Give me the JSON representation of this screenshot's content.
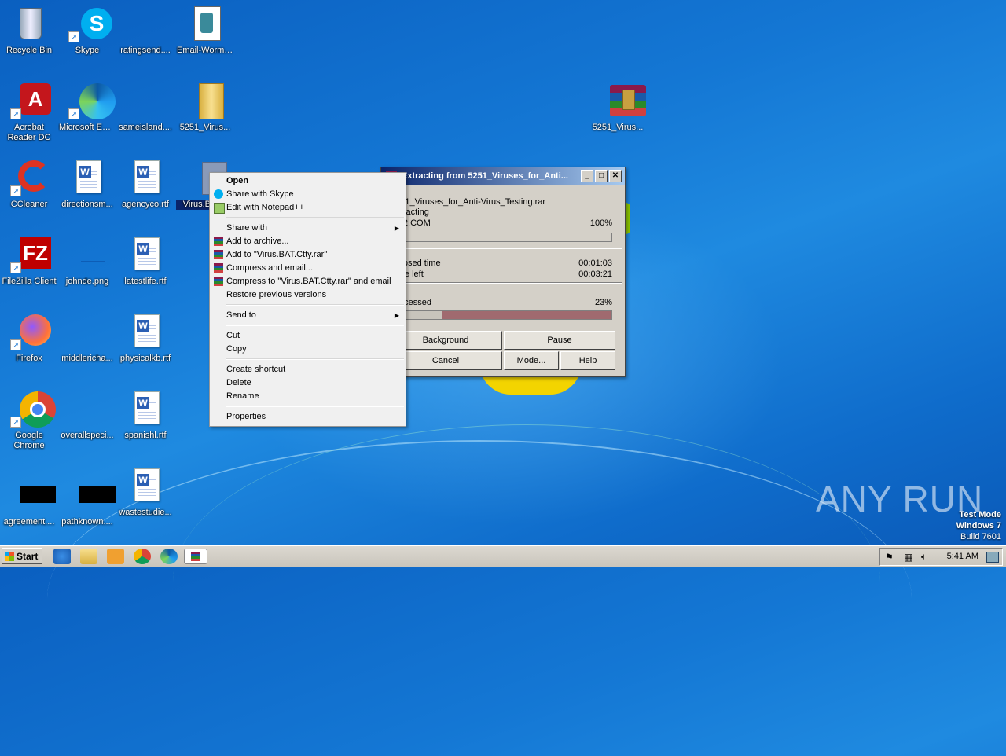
{
  "desktop": {
    "icons": [
      {
        "label": "Recycle Bin"
      },
      {
        "label": "Skype"
      },
      {
        "label": "ratingsend...."
      },
      {
        "label": "Email-Worm...."
      },
      {
        "label": "Acrobat Reader DC"
      },
      {
        "label": "Microsoft Edge"
      },
      {
        "label": "sameisland...."
      },
      {
        "label": "5251_Virus..."
      },
      {
        "label": "5251_Virus..."
      },
      {
        "label": "CCleaner"
      },
      {
        "label": "directionsm..."
      },
      {
        "label": "agencyco.rtf"
      },
      {
        "label": "Virus.BAT..."
      },
      {
        "label": "FileZilla Client"
      },
      {
        "label": "johnde.png"
      },
      {
        "label": "latestlife.rtf"
      },
      {
        "label": "Firefox"
      },
      {
        "label": "middlericha..."
      },
      {
        "label": "physicalkb.rtf"
      },
      {
        "label": "Google Chrome"
      },
      {
        "label": "overallspeci..."
      },
      {
        "label": "spanishl.rtf"
      },
      {
        "label": "agreement...."
      },
      {
        "label": "pathknown...."
      },
      {
        "label": "wastestudie..."
      }
    ]
  },
  "dialog": {
    "title": "Extracting from 5251_Viruses_for_Anti...",
    "archive": "5251_Viruses_for_Anti-Virus_Testing.rar",
    "status": "Extracting",
    "current_file": "-382.COM",
    "file_percent": "100%",
    "file_progress": 1.0,
    "elapsed_label": "Elapsed time",
    "elapsed_value": "00:01:03",
    "left_label": "Time left",
    "left_value": "00:03:21",
    "processed_label": "Processed",
    "processed_percent": "23%",
    "processed_progress": 0.23,
    "buttons": {
      "background": "Background",
      "pause": "Pause",
      "cancel": "Cancel",
      "mode": "Mode...",
      "help": "Help"
    }
  },
  "context_menu": {
    "open": "Open",
    "share_skype": "Share with Skype",
    "edit_notepad": "Edit with Notepad++",
    "share_with": "Share with",
    "add_archive": "Add to archive...",
    "add_rar": "Add to \"Virus.BAT.Ctty.rar\"",
    "compress_email": "Compress and email...",
    "compress_rar_email": "Compress to \"Virus.BAT.Ctty.rar\" and email",
    "restore": "Restore previous versions",
    "send_to": "Send to",
    "cut": "Cut",
    "copy": "Copy",
    "create_shortcut": "Create shortcut",
    "delete": "Delete",
    "rename": "Rename",
    "properties": "Properties"
  },
  "taskbar": {
    "start_label": "Start",
    "clock": "5:41 AM"
  },
  "overlay": {
    "watermark": "ANY RUN",
    "test_mode": "Test Mode",
    "os": "Windows 7",
    "build": "Build 7601"
  }
}
